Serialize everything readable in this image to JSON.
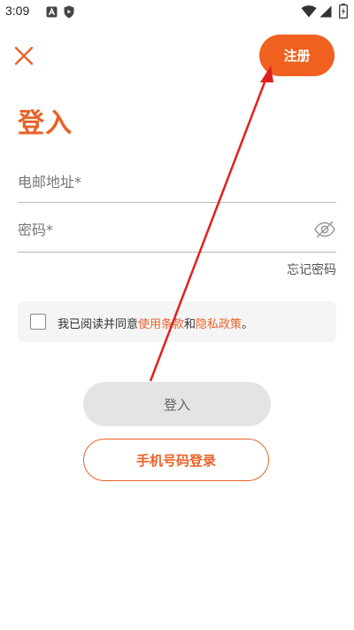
{
  "status_bar": {
    "time": "3:09",
    "icons": [
      "a-notification-icon",
      "shield-icon",
      "wifi-icon",
      "signal-icon",
      "battery-icon"
    ]
  },
  "header": {
    "close_icon": "close-icon",
    "register_label": "注册"
  },
  "title": "登入",
  "form": {
    "email": {
      "placeholder": "电邮地址*",
      "value": ""
    },
    "password": {
      "placeholder": "密码*",
      "value": "",
      "toggle_icon": "eye-off-icon"
    },
    "forgot_password": "忘记密码"
  },
  "terms": {
    "checked": false,
    "prefix": "我已阅读并同意",
    "terms_link": "使用条款",
    "middle": "和",
    "privacy_link": "隐私政策",
    "suffix": "。"
  },
  "buttons": {
    "login": "登入",
    "phone_login": "手机号码登录"
  },
  "colors": {
    "accent": "#e8632a",
    "register_bg": "#f0601e",
    "annotation_arrow": "#e0201e",
    "disabled_button": "#e4e4e4"
  }
}
